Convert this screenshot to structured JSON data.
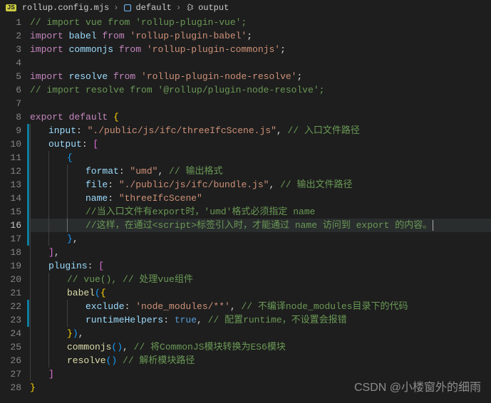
{
  "breadcrumb": {
    "file_badge": "JS",
    "file": "rollup.config.mjs",
    "symbol1": "default",
    "symbol2": "output"
  },
  "active_line": 16,
  "watermark": "CSDN @小楼窗外的细雨",
  "lines": [
    {
      "n": 1,
      "ind": 0,
      "tokens": [
        [
          "c-comment",
          "// import vue from 'rollup-plugin-vue';"
        ]
      ]
    },
    {
      "n": 2,
      "ind": 0,
      "tokens": [
        [
          "c-keyword",
          "import"
        ],
        [
          "",
          ""
        ],
        [
          "c-ident",
          " babel "
        ],
        [
          "c-keyword",
          "from"
        ],
        [
          "",
          ""
        ],
        [
          "c-string",
          " 'rollup-plugin-babel'"
        ],
        [
          "c-punct",
          ";"
        ]
      ]
    },
    {
      "n": 3,
      "ind": 0,
      "tokens": [
        [
          "c-keyword",
          "import"
        ],
        [
          "",
          ""
        ],
        [
          "c-ident",
          " commonjs "
        ],
        [
          "c-keyword",
          "from"
        ],
        [
          "",
          ""
        ],
        [
          "c-string",
          " 'rollup-plugin-commonjs'"
        ],
        [
          "c-punct",
          ";"
        ]
      ]
    },
    {
      "n": 4,
      "ind": 0,
      "tokens": []
    },
    {
      "n": 5,
      "ind": 0,
      "tokens": [
        [
          "c-keyword",
          "import"
        ],
        [
          "",
          ""
        ],
        [
          "c-ident",
          " resolve "
        ],
        [
          "c-keyword",
          "from"
        ],
        [
          "",
          ""
        ],
        [
          "c-string",
          " 'rollup-plugin-node-resolve'"
        ],
        [
          "c-punct",
          ";"
        ]
      ]
    },
    {
      "n": 6,
      "ind": 0,
      "tokens": [
        [
          "c-comment",
          "// import resolve from '@rollup/plugin-node-resolve';"
        ]
      ]
    },
    {
      "n": 7,
      "ind": 0,
      "tokens": []
    },
    {
      "n": 8,
      "ind": 0,
      "tokens": [
        [
          "c-keyword",
          "export"
        ],
        [
          "",
          ""
        ],
        [
          "c-keyword",
          " default"
        ],
        [
          "",
          ""
        ],
        [
          "c-brace-y",
          " {"
        ]
      ]
    },
    {
      "n": 9,
      "ind": 1,
      "mod": true,
      "tokens": [
        [
          "c-ident",
          "input"
        ],
        [
          "c-punct",
          ": "
        ],
        [
          "c-string",
          "\"./public/js/ifc/threeIfcScene.js\""
        ],
        [
          "c-punct",
          ","
        ],
        [
          "",
          ""
        ],
        [
          "c-comment",
          " // 入口文件路径"
        ]
      ]
    },
    {
      "n": 10,
      "ind": 1,
      "mod": true,
      "tokens": [
        [
          "c-ident",
          "output"
        ],
        [
          "c-punct",
          ": "
        ],
        [
          "c-brace-p",
          "["
        ]
      ]
    },
    {
      "n": 11,
      "ind": 2,
      "mod": true,
      "tokens": [
        [
          "c-brace-b",
          "{"
        ]
      ]
    },
    {
      "n": 12,
      "ind": 3,
      "mod": true,
      "tokens": [
        [
          "c-ident",
          "format"
        ],
        [
          "c-punct",
          ": "
        ],
        [
          "c-string",
          "\"umd\""
        ],
        [
          "c-punct",
          ","
        ],
        [
          "",
          ""
        ],
        [
          "c-comment",
          " // 输出格式"
        ]
      ]
    },
    {
      "n": 13,
      "ind": 3,
      "mod": true,
      "tokens": [
        [
          "c-ident",
          "file"
        ],
        [
          "c-punct",
          ": "
        ],
        [
          "c-string",
          "\"./public/js/ifc/bundle.js\""
        ],
        [
          "c-punct",
          ","
        ],
        [
          "",
          ""
        ],
        [
          "c-comment",
          " // 输出文件路径"
        ]
      ]
    },
    {
      "n": 14,
      "ind": 3,
      "mod": true,
      "tokens": [
        [
          "c-ident",
          "name"
        ],
        [
          "c-punct",
          ": "
        ],
        [
          "c-string",
          "\"threeIfcScene\""
        ]
      ]
    },
    {
      "n": 15,
      "ind": 3,
      "mod": true,
      "tokens": [
        [
          "c-comment",
          "//当入口文件有export时，'umd'格式必须指定 name"
        ]
      ]
    },
    {
      "n": 16,
      "ind": 3,
      "mod": true,
      "active": true,
      "tokens": [
        [
          "c-comment",
          "//这样，在通过<script>标签引入时，才能通过 name 访问到 export 的内容。"
        ]
      ]
    },
    {
      "n": 17,
      "ind": 2,
      "mod": true,
      "tokens": [
        [
          "c-brace-b",
          "}"
        ],
        [
          "c-punct",
          ","
        ]
      ]
    },
    {
      "n": 18,
      "ind": 1,
      "tokens": [
        [
          "c-brace-p",
          "]"
        ],
        [
          "c-punct",
          ","
        ]
      ]
    },
    {
      "n": 19,
      "ind": 1,
      "tokens": [
        [
          "c-ident",
          "plugins"
        ],
        [
          "c-punct",
          ": "
        ],
        [
          "c-brace-p",
          "["
        ]
      ]
    },
    {
      "n": 20,
      "ind": 2,
      "tokens": [
        [
          "c-comment",
          "// vue(), // 处理vue组件"
        ]
      ]
    },
    {
      "n": 21,
      "ind": 2,
      "tokens": [
        [
          "c-func",
          "babel"
        ],
        [
          "c-brace-b",
          "("
        ],
        [
          "c-brace-y",
          "{"
        ]
      ]
    },
    {
      "n": 22,
      "ind": 3,
      "mod": true,
      "tokens": [
        [
          "c-ident",
          "exclude"
        ],
        [
          "c-punct",
          ": "
        ],
        [
          "c-string",
          "'node_modules/**'"
        ],
        [
          "c-punct",
          ","
        ],
        [
          "",
          ""
        ],
        [
          "c-comment",
          " // 不编译node_modules目录下的代码"
        ]
      ]
    },
    {
      "n": 23,
      "ind": 3,
      "mod": true,
      "tokens": [
        [
          "c-ident",
          "runtimeHelpers"
        ],
        [
          "c-punct",
          ": "
        ],
        [
          "c-const",
          "true"
        ],
        [
          "c-punct",
          ","
        ],
        [
          "",
          ""
        ],
        [
          "c-comment",
          " // 配置runtime，不设置会报错"
        ]
      ]
    },
    {
      "n": 24,
      "ind": 2,
      "tokens": [
        [
          "c-brace-y",
          "}"
        ],
        [
          "c-brace-b",
          ")"
        ],
        [
          "c-punct",
          ","
        ]
      ]
    },
    {
      "n": 25,
      "ind": 2,
      "tokens": [
        [
          "c-func",
          "commonjs"
        ],
        [
          "c-brace-b",
          "()"
        ],
        [
          "c-punct",
          ","
        ],
        [
          "",
          ""
        ],
        [
          "c-comment",
          " // 将CommonJS模块转换为ES6模块"
        ]
      ]
    },
    {
      "n": 26,
      "ind": 2,
      "tokens": [
        [
          "c-func",
          "resolve"
        ],
        [
          "c-brace-b",
          "()"
        ],
        [
          "",
          ""
        ],
        [
          "c-comment",
          " // 解析模块路径"
        ]
      ]
    },
    {
      "n": 27,
      "ind": 1,
      "tokens": [
        [
          "c-brace-p",
          "]"
        ]
      ]
    },
    {
      "n": 28,
      "ind": 0,
      "tokens": [
        [
          "c-brace-y",
          "}"
        ]
      ]
    }
  ]
}
